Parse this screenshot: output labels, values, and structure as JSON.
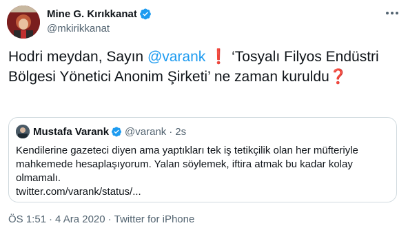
{
  "author": {
    "display_name": "Mine G. Kırıkkanat",
    "handle": "@mkirikkanat",
    "verified_color": "#1d9bf0"
  },
  "tweet": {
    "text_part1": "Hodri meydan, Sayın ",
    "mention": "@varank",
    "exclamation": "❗",
    "text_part2": " ‘Tosyalı Filyos Endüstri Bölgesi Yönetici Anonim Şirketi’ ne zaman kuruldu",
    "question": "❓"
  },
  "quoted_tweet": {
    "display_name": "Mustafa Varank",
    "handle": "@varank",
    "separator": "·",
    "time": "2s",
    "text": "Kendilerine gazeteci diyen ama yaptıkları tek iş tetikçilik olan her müfteriyle mahkemede hesaplaşıyorum. Yalan söylemek, iftira atmak bu kadar kolay olmamalı.",
    "link": "twitter.com/varank/status/..."
  },
  "footer": {
    "time": "ÖS 1:51",
    "separator": "·",
    "date": "4 Ara 2020",
    "source": "Twitter for iPhone"
  },
  "colors": {
    "accent": "#1d9bf0",
    "text": "#0f1419",
    "muted": "#536471",
    "border": "#cfd9de",
    "emoji_red": "#e0202a"
  },
  "icons": {
    "verified": "verified-badge-icon",
    "more": "more-options-icon"
  }
}
